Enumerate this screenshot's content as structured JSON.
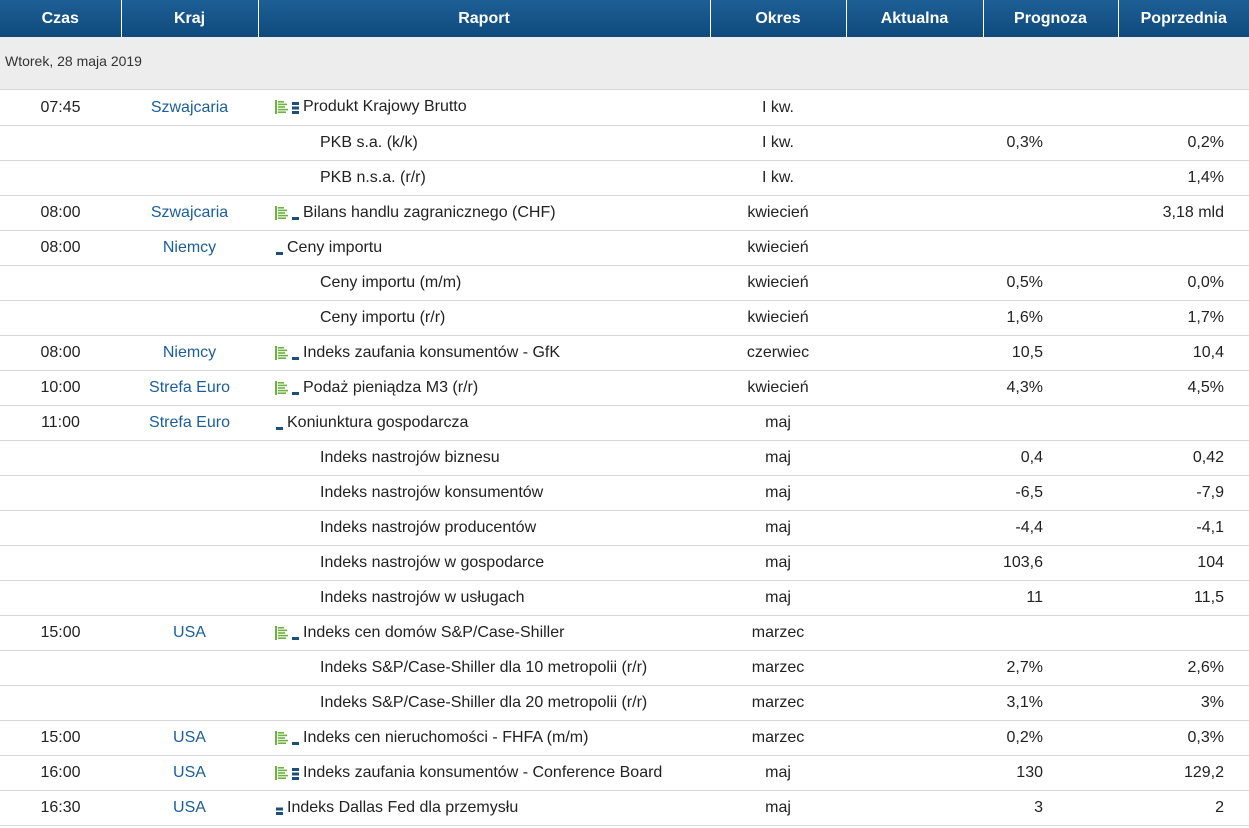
{
  "header": {
    "czas": "Czas",
    "kraj": "Kraj",
    "raport": "Raport",
    "okres": "Okres",
    "aktualna": "Aktualna",
    "prognoza": "Prognoza",
    "poprzednia": "Poprzednia"
  },
  "date_label": "Wtorek, 28 maja 2019",
  "colors": {
    "header_bg": "#0f4a7d",
    "country_link": "#1a5f9a",
    "chart_icon": "#6cb33f",
    "importance_icon": "#1d4f7c"
  },
  "rows": [
    {
      "czas": "07:45",
      "kraj": "Szwajcaria",
      "raport": "Produkt Krajowy Brutto",
      "okres": "I kw.",
      "aktualna": "",
      "prognoza": "",
      "poprzednia": "",
      "chart": true,
      "importance": 3
    },
    {
      "czas": "",
      "kraj": "",
      "raport": "PKB s.a. (k/k)",
      "okres": "I kw.",
      "aktualna": "",
      "prognoza": "0,3%",
      "poprzednia": "0,2%",
      "sub": true
    },
    {
      "czas": "",
      "kraj": "",
      "raport": "PKB n.s.a. (r/r)",
      "okres": "I kw.",
      "aktualna": "",
      "prognoza": "",
      "poprzednia": "1,4%",
      "sub": true
    },
    {
      "czas": "08:00",
      "kraj": "Szwajcaria",
      "raport": "Bilans handlu zagranicznego (CHF)",
      "okres": "kwiecień",
      "aktualna": "",
      "prognoza": "",
      "poprzednia": "3,18 mld",
      "chart": true,
      "importance": 1
    },
    {
      "czas": "08:00",
      "kraj": "Niemcy",
      "raport": "Ceny importu",
      "okres": "kwiecień",
      "aktualna": "",
      "prognoza": "",
      "poprzednia": "",
      "chart": false,
      "importance": 1
    },
    {
      "czas": "",
      "kraj": "",
      "raport": "Ceny importu (m/m)",
      "okres": "kwiecień",
      "aktualna": "",
      "prognoza": "0,5%",
      "poprzednia": "0,0%",
      "sub": true
    },
    {
      "czas": "",
      "kraj": "",
      "raport": "Ceny importu (r/r)",
      "okres": "kwiecień",
      "aktualna": "",
      "prognoza": "1,6%",
      "poprzednia": "1,7%",
      "sub": true
    },
    {
      "czas": "08:00",
      "kraj": "Niemcy",
      "raport": "Indeks zaufania konsumentów - GfK",
      "okres": "czerwiec",
      "aktualna": "",
      "prognoza": "10,5",
      "poprzednia": "10,4",
      "chart": true,
      "importance": 1
    },
    {
      "czas": "10:00",
      "kraj": "Strefa Euro",
      "raport": "Podaż pieniądza M3 (r/r)",
      "okres": "kwiecień",
      "aktualna": "",
      "prognoza": "4,3%",
      "poprzednia": "4,5%",
      "chart": true,
      "importance": 1
    },
    {
      "czas": "11:00",
      "kraj": "Strefa Euro",
      "raport": "Koniunktura gospodarcza",
      "okres": "maj",
      "aktualna": "",
      "prognoza": "",
      "poprzednia": "",
      "chart": false,
      "importance": 1
    },
    {
      "czas": "",
      "kraj": "",
      "raport": "Indeks nastrojów biznesu",
      "okres": "maj",
      "aktualna": "",
      "prognoza": "0,4",
      "poprzednia": "0,42",
      "sub": true
    },
    {
      "czas": "",
      "kraj": "",
      "raport": "Indeks nastrojów konsumentów",
      "okres": "maj",
      "aktualna": "",
      "prognoza": "-6,5",
      "poprzednia": "-7,9",
      "sub": true
    },
    {
      "czas": "",
      "kraj": "",
      "raport": "Indeks nastrojów producentów",
      "okres": "maj",
      "aktualna": "",
      "prognoza": "-4,4",
      "poprzednia": "-4,1",
      "sub": true
    },
    {
      "czas": "",
      "kraj": "",
      "raport": "Indeks nastrojów w gospodarce",
      "okres": "maj",
      "aktualna": "",
      "prognoza": "103,6",
      "poprzednia": "104",
      "sub": true
    },
    {
      "czas": "",
      "kraj": "",
      "raport": "Indeks nastrojów w usługach",
      "okres": "maj",
      "aktualna": "",
      "prognoza": "11",
      "poprzednia": "11,5",
      "sub": true
    },
    {
      "czas": "15:00",
      "kraj": "USA",
      "raport": "Indeks cen domów S&P/Case-Shiller",
      "okres": "marzec",
      "aktualna": "",
      "prognoza": "",
      "poprzednia": "",
      "chart": true,
      "importance": 1
    },
    {
      "czas": "",
      "kraj": "",
      "raport": "Indeks S&P/Case-Shiller dla 10 metropolii (r/r)",
      "okres": "marzec",
      "aktualna": "",
      "prognoza": "2,7%",
      "poprzednia": "2,6%",
      "sub": true
    },
    {
      "czas": "",
      "kraj": "",
      "raport": "Indeks S&P/Case-Shiller dla 20 metropolii (r/r)",
      "okres": "marzec",
      "aktualna": "",
      "prognoza": "3,1%",
      "poprzednia": "3%",
      "sub": true
    },
    {
      "czas": "15:00",
      "kraj": "USA",
      "raport": "Indeks cen nieruchomości - FHFA (m/m)",
      "okres": "marzec",
      "aktualna": "",
      "prognoza": "0,2%",
      "poprzednia": "0,3%",
      "chart": true,
      "importance": 1
    },
    {
      "czas": "16:00",
      "kraj": "USA",
      "raport": "Indeks zaufania konsumentów - Conference Board",
      "okres": "maj",
      "aktualna": "",
      "prognoza": "130",
      "poprzednia": "129,2",
      "chart": true,
      "importance": 3
    },
    {
      "czas": "16:30",
      "kraj": "USA",
      "raport": "Indeks Dallas Fed dla przemysłu",
      "okres": "maj",
      "aktualna": "",
      "prognoza": "3",
      "poprzednia": "2",
      "chart": false,
      "importance": 2
    }
  ]
}
